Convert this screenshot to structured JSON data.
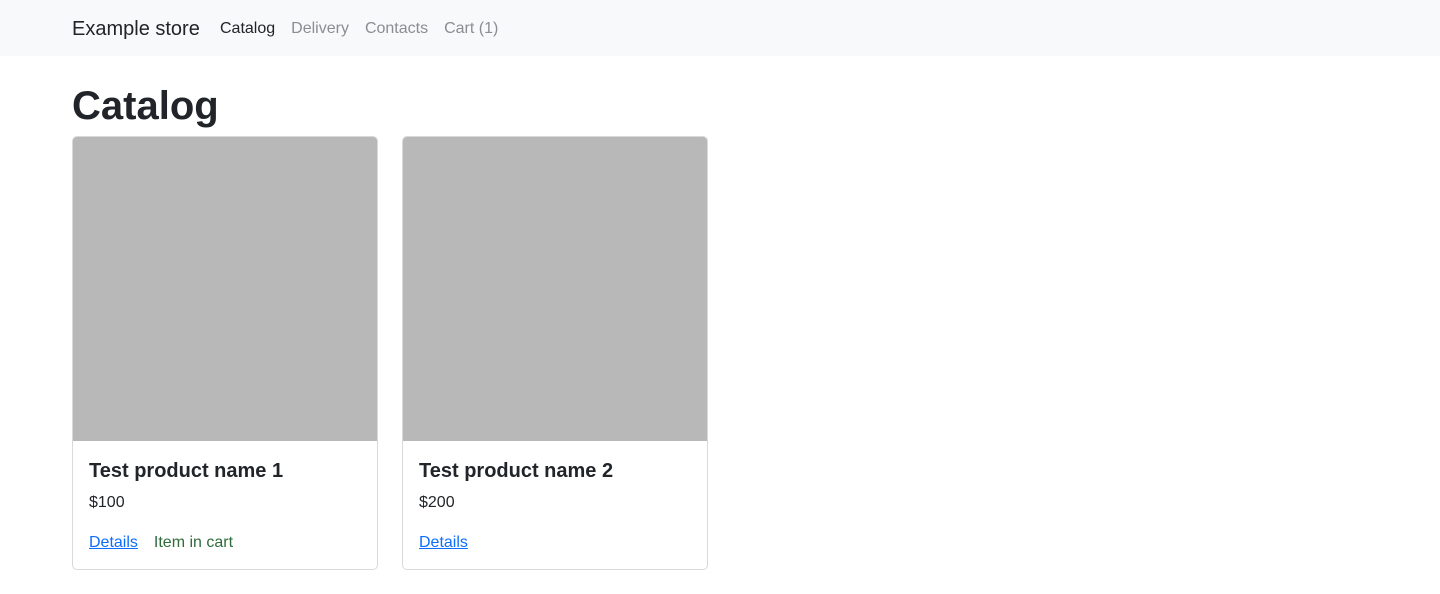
{
  "navbar": {
    "brand": "Example store",
    "items": [
      {
        "label": "Catalog",
        "active": true
      },
      {
        "label": "Delivery",
        "active": false
      },
      {
        "label": "Contacts",
        "active": false
      },
      {
        "label": "Cart (1)",
        "active": false
      }
    ]
  },
  "page": {
    "title": "Catalog"
  },
  "products": [
    {
      "name": "Test product name 1",
      "price": "$100",
      "details_label": "Details",
      "status_label": "Item in cart"
    },
    {
      "name": "Test product name 2",
      "price": "$200",
      "details_label": "Details"
    }
  ],
  "colors": {
    "navbar_bg": "#f8f9fa",
    "link": "#0d6efd",
    "in_cart": "#2f6b3a",
    "image_placeholder": "#b8b8b8"
  }
}
